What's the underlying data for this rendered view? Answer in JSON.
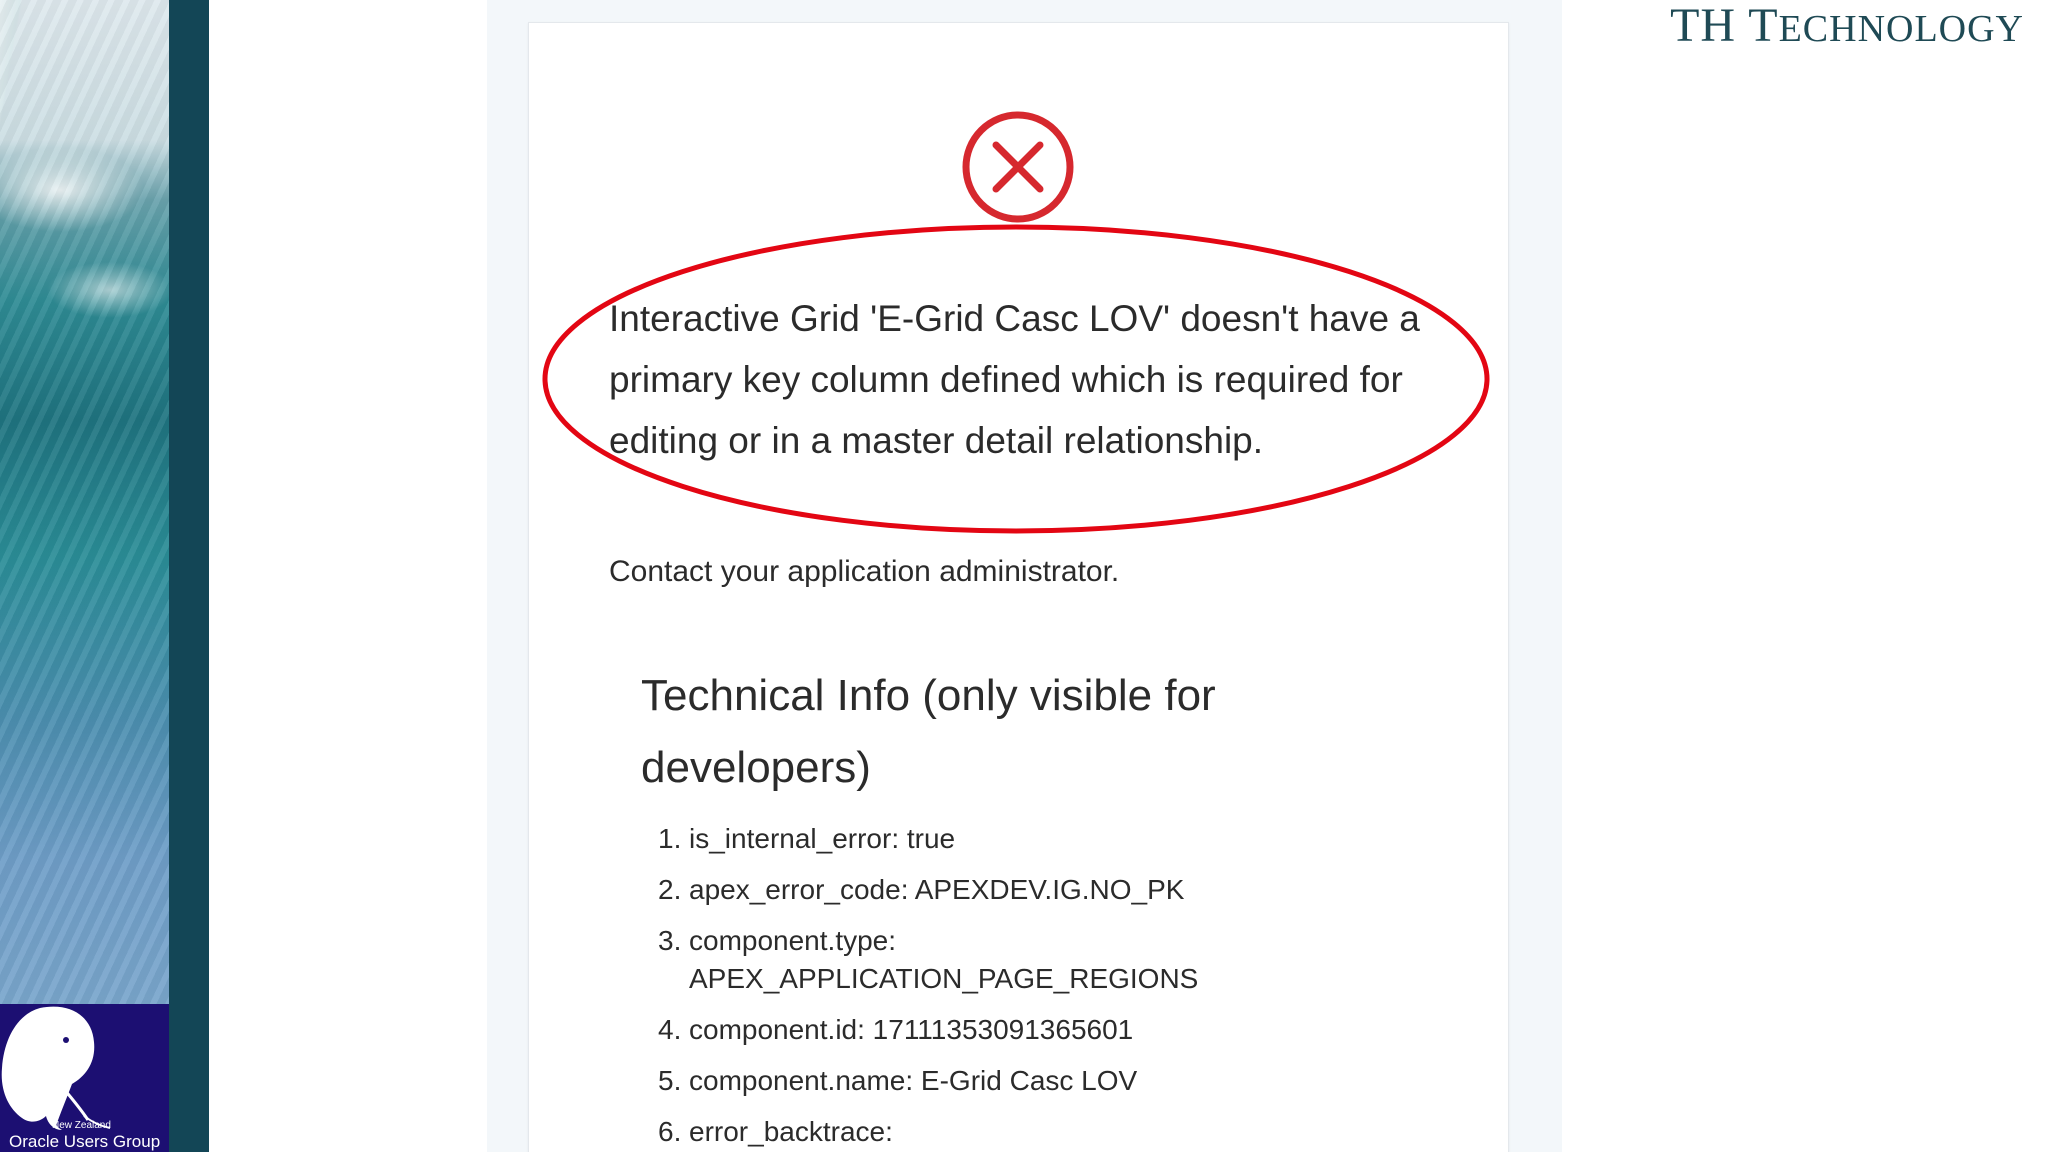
{
  "brand": {
    "first": "TH",
    "second_initial": "T",
    "second_rest": "ECHNOLOGY"
  },
  "logo": {
    "small": "New Zealand",
    "big": "Oracle Users Group"
  },
  "error": {
    "message": "Interactive Grid 'E-Grid Casc LOV' doesn't have a primary key column defined which is required for editing or in a master detail relationship.",
    "contact": "Contact your application administrator.",
    "icon": "error-x-circle-icon",
    "icon_color": "#d6282e",
    "highlight_color": "#e30613"
  },
  "technical_info": {
    "heading": "Technical Info (only visible for developers)",
    "items": [
      {
        "num": "1.",
        "text": "is_internal_error: true"
      },
      {
        "num": "2.",
        "text": "apex_error_code: APEXDEV.IG.NO_PK"
      },
      {
        "num": "3.",
        "text": "component.type:",
        "cont": "APEX_APPLICATION_PAGE_REGIONS"
      },
      {
        "num": "4.",
        "text": "component.id: 17111353091365601"
      },
      {
        "num": "5.",
        "text": "component.name: E-Grid Casc LOV"
      },
      {
        "num": "6.",
        "text": "error_backtrace:"
      }
    ]
  }
}
